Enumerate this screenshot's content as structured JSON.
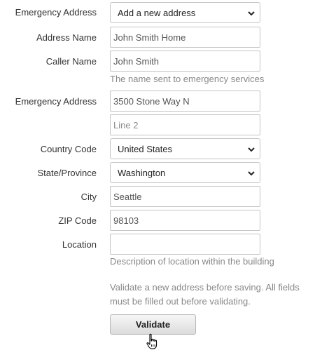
{
  "form": {
    "emergency_address_select": {
      "label": "Emergency Address",
      "value": "Add a new address"
    },
    "address_name": {
      "label": "Address Name",
      "value": "John Smith Home"
    },
    "caller_name": {
      "label": "Caller Name",
      "value": "John Smith",
      "help": "The name sent to emergency services"
    },
    "emergency_address": {
      "label": "Emergency Address",
      "line1_value": "3500 Stone Way N",
      "line2_placeholder": "Line 2"
    },
    "country_code": {
      "label": "Country Code",
      "value": "United States"
    },
    "state_province": {
      "label": "State/Province",
      "value": "Washington"
    },
    "city": {
      "label": "City",
      "value": "Seattle"
    },
    "zip_code": {
      "label": "ZIP Code",
      "value": "98103"
    },
    "location": {
      "label": "Location",
      "value": "",
      "help": "Description of location within the building"
    },
    "validate_help_line1": "Validate a new address before saving. All fields",
    "validate_help_line2": "must be filled out before validating.",
    "validate_button": "Validate"
  },
  "icons": {
    "select_chevron": "chevron-down-icon",
    "cursor": "hand-pointer-icon"
  },
  "colors": {
    "border": "#c4c4c4",
    "help_text": "#888888",
    "label_text": "#333333"
  }
}
